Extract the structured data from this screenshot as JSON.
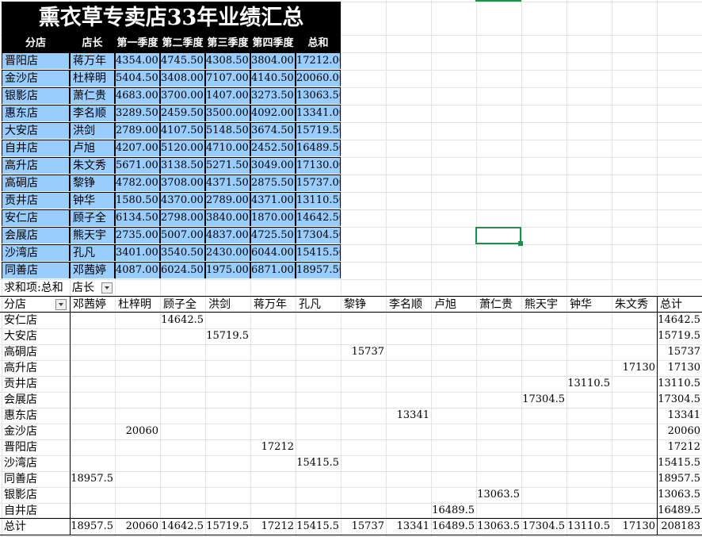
{
  "title": "熏衣草专卖店33年业绩汇总",
  "headers": [
    "分店",
    "店长",
    "第一季度",
    "第二季度",
    "第三季度",
    "第四季度",
    "总和"
  ],
  "rows": [
    [
      "晋阳店",
      "蒋万年",
      "4354.00",
      "4745.50",
      "4308.50",
      "3804.00",
      "17212.00"
    ],
    [
      "金沙店",
      "杜梓明",
      "5404.50",
      "3408.00",
      "7107.00",
      "4140.50",
      "20060.00"
    ],
    [
      "银影店",
      "萧仁贵",
      "4683.00",
      "3700.00",
      "1407.00",
      "3273.50",
      "13063.50"
    ],
    [
      "惠东店",
      "李名顺",
      "3289.50",
      "2459.50",
      "3500.00",
      "4092.00",
      "13341.00"
    ],
    [
      "大安店",
      "洪剑",
      "2789.00",
      "4107.50",
      "5148.50",
      "3674.50",
      "15719.50"
    ],
    [
      "自井店",
      "卢旭",
      "4207.00",
      "5120.00",
      "4710.00",
      "2452.50",
      "16489.50"
    ],
    [
      "高升店",
      "朱文秀",
      "5671.00",
      "3138.50",
      "5271.50",
      "3049.00",
      "17130.00"
    ],
    [
      "高硐店",
      "黎铮",
      "4782.00",
      "3708.00",
      "4371.50",
      "2875.50",
      "15737.00"
    ],
    [
      "贡井店",
      "钟华",
      "1580.50",
      "4370.00",
      "2789.00",
      "4371.00",
      "13110.50"
    ],
    [
      "安仁店",
      "顾子全",
      "6134.50",
      "2798.00",
      "3840.00",
      "1870.00",
      "14642.50"
    ],
    [
      "会展店",
      "熊天宇",
      "2735.00",
      "5007.00",
      "4837.00",
      "4725.50",
      "17304.50"
    ],
    [
      "沙湾店",
      "孔凡",
      "3401.00",
      "3540.50",
      "2430.00",
      "6044.00",
      "15415.50"
    ],
    [
      "同善店",
      "邓茜婷",
      "4087.00",
      "6024.50",
      "1975.00",
      "6871.00",
      "18957.50"
    ]
  ],
  "pivot": {
    "value_label": "求和项:总和",
    "col_field": "店长",
    "row_field": "分店",
    "columns": [
      "邓茜婷",
      "杜梓明",
      "顾子全",
      "洪剑",
      "蒋万年",
      "孔凡",
      "黎铮",
      "李名顺",
      "卢旭",
      "萧仁贵",
      "熊天宇",
      "钟华",
      "朱文秀"
    ],
    "total_label": "总计",
    "rows": [
      {
        "label": "安仁店",
        "col": 2,
        "value": "14642.5",
        "total": "14642.5"
      },
      {
        "label": "大安店",
        "col": 3,
        "value": "15719.5",
        "total": "15719.5"
      },
      {
        "label": "高硐店",
        "col": 6,
        "value": "15737",
        "total": "15737"
      },
      {
        "label": "高升店",
        "col": 12,
        "value": "17130",
        "total": "17130"
      },
      {
        "label": "贡井店",
        "col": 11,
        "value": "13110.5",
        "total": "13110.5"
      },
      {
        "label": "会展店",
        "col": 10,
        "value": "17304.5",
        "total": "17304.5"
      },
      {
        "label": "惠东店",
        "col": 7,
        "value": "13341",
        "total": "13341"
      },
      {
        "label": "金沙店",
        "col": 1,
        "value": "20060",
        "total": "20060"
      },
      {
        "label": "晋阳店",
        "col": 4,
        "value": "17212",
        "total": "17212"
      },
      {
        "label": "沙湾店",
        "col": 5,
        "value": "15415.5",
        "total": "15415.5"
      },
      {
        "label": "同善店",
        "col": 0,
        "value": "18957.5",
        "total": "18957.5"
      },
      {
        "label": "银影店",
        "col": 9,
        "value": "13063.5",
        "total": "13063.5"
      },
      {
        "label": "自井店",
        "col": 8,
        "value": "16489.5",
        "total": "16489.5"
      }
    ],
    "grand_totals": [
      "18957.5",
      "20060",
      "14642.5",
      "15719.5",
      "17212",
      "15415.5",
      "15737",
      "13341",
      "16489.5",
      "13063.5",
      "17304.5",
      "13110.5",
      "17130"
    ],
    "grand_total": "208183"
  }
}
